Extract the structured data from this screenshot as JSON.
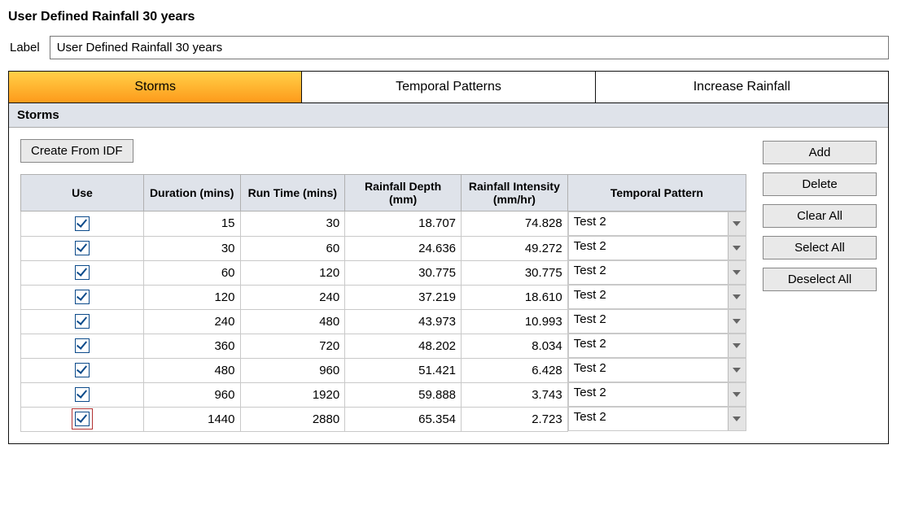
{
  "title": "User Defined Rainfall 30 years",
  "labelRow": {
    "caption": "Label",
    "value": "User Defined Rainfall 30 years"
  },
  "tabs": [
    "Storms",
    "Temporal Patterns",
    "Increase Rainfall"
  ],
  "panel": {
    "header": "Storms",
    "createFromIdf": "Create From IDF"
  },
  "sideButtons": [
    "Add",
    "Delete",
    "Clear All",
    "Select All",
    "Deselect All"
  ],
  "columns": {
    "use": "Use",
    "duration": "Duration (mins)",
    "runtime": "Run Time (mins)",
    "depth": "Rainfall Depth (mm)",
    "intensity": "Rainfall Intensity (mm/hr)",
    "pattern": "Temporal Pattern"
  },
  "rows": [
    {
      "use": true,
      "duration": "15",
      "runtime": "30",
      "depth": "18.707",
      "intensity": "74.828",
      "pattern": "Test 2"
    },
    {
      "use": true,
      "duration": "30",
      "runtime": "60",
      "depth": "24.636",
      "intensity": "49.272",
      "pattern": "Test 2"
    },
    {
      "use": true,
      "duration": "60",
      "runtime": "120",
      "depth": "30.775",
      "intensity": "30.775",
      "pattern": "Test 2"
    },
    {
      "use": true,
      "duration": "120",
      "runtime": "240",
      "depth": "37.219",
      "intensity": "18.610",
      "pattern": "Test 2"
    },
    {
      "use": true,
      "duration": "240",
      "runtime": "480",
      "depth": "43.973",
      "intensity": "10.993",
      "pattern": "Test 2"
    },
    {
      "use": true,
      "duration": "360",
      "runtime": "720",
      "depth": "48.202",
      "intensity": "8.034",
      "pattern": "Test 2"
    },
    {
      "use": true,
      "duration": "480",
      "runtime": "960",
      "depth": "51.421",
      "intensity": "6.428",
      "pattern": "Test 2"
    },
    {
      "use": true,
      "duration": "960",
      "runtime": "1920",
      "depth": "59.888",
      "intensity": "3.743",
      "pattern": "Test 2"
    },
    {
      "use": true,
      "duration": "1440",
      "runtime": "2880",
      "depth": "65.354",
      "intensity": "2.723",
      "pattern": "Test 2"
    }
  ],
  "selectedRowIndex": 8
}
